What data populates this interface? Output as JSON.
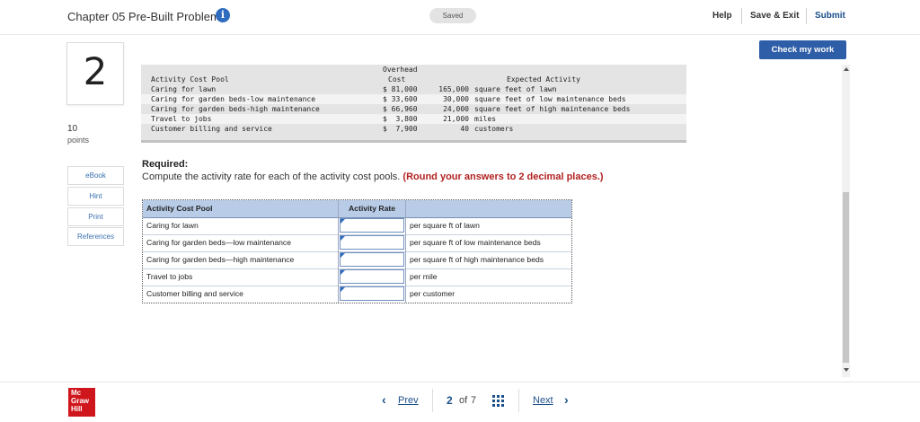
{
  "header": {
    "title": "Chapter 05 Pre-Built Problems",
    "info_icon": "i",
    "status": "Saved",
    "links": {
      "help": "Help",
      "save_exit": "Save & Exit",
      "submit": "Submit"
    }
  },
  "check_button": "Check my work",
  "question": {
    "number": "2",
    "points_value": "10",
    "points_label": "points"
  },
  "sidebar": {
    "items": [
      "eBook",
      "Hint",
      "Print",
      "References"
    ]
  },
  "data_table": {
    "headers": {
      "pool": "Activity Cost Pool",
      "cost_line1": "Overhead",
      "cost_line2": "Cost",
      "activity": "Expected Activity"
    },
    "rows": [
      {
        "pool": "Caring for lawn",
        "cost": "$ 81,000",
        "qty": "165,000",
        "unit": "square feet of lawn"
      },
      {
        "pool": "Caring for garden beds-low maintenance",
        "cost": "$ 33,600",
        "qty": "30,000",
        "unit": "square feet of low maintenance beds"
      },
      {
        "pool": "Caring for garden beds-high maintenance",
        "cost": "$ 66,960",
        "qty": "24,000",
        "unit": "square feet of high maintenance beds"
      },
      {
        "pool": "Travel to jobs",
        "cost": "$  3,800",
        "qty": "21,000",
        "unit": "miles"
      },
      {
        "pool": "Customer billing and service",
        "cost": "$  7,900",
        "qty": "40",
        "unit": "customers"
      }
    ]
  },
  "required": {
    "label": "Required:",
    "text": "Compute the activity rate for each of the activity cost pools. ",
    "emphasis": "(Round your answers to 2 decimal places.)"
  },
  "answer_table": {
    "headers": {
      "pool": "Activity Cost Pool",
      "rate": "Activity Rate"
    },
    "rows": [
      {
        "pool": "Caring for lawn",
        "rate": "",
        "unit": "per square ft of lawn"
      },
      {
        "pool": "Caring for garden beds—low maintenance",
        "rate": "",
        "unit": "per square ft of low maintenance beds"
      },
      {
        "pool": "Caring for garden beds—high maintenance",
        "rate": "",
        "unit": "per square ft of high maintenance beds"
      },
      {
        "pool": "Travel to jobs",
        "rate": "",
        "unit": "per mile"
      },
      {
        "pool": "Customer billing and service",
        "rate": "",
        "unit": "per customer"
      }
    ]
  },
  "footer": {
    "logo_lines": [
      "Mc",
      "Graw",
      "Hill"
    ],
    "prev_label": "Prev",
    "next_label": "Next",
    "prev_arrow": "‹",
    "next_arrow": "›",
    "page_current": "2",
    "page_of": "of",
    "page_total": "7"
  },
  "colors": {
    "primary": "#2f5ea8",
    "table_header": "#b8cce8",
    "emphasis": "#b22222",
    "logo": "#d0161d"
  }
}
